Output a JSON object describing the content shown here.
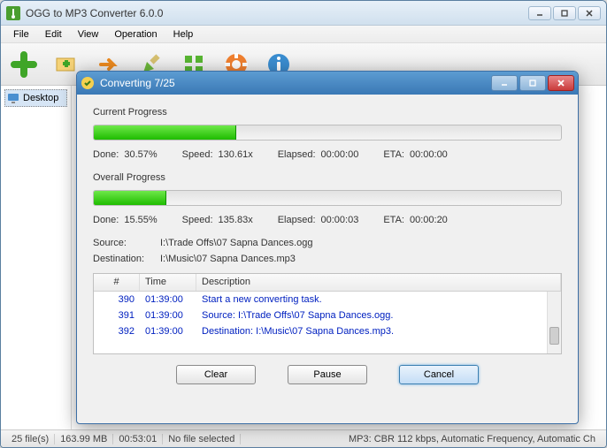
{
  "main": {
    "title": "OGG to MP3 Converter 6.0.0",
    "menu": [
      "File",
      "Edit",
      "View",
      "Operation",
      "Help"
    ],
    "tree": {
      "desktop": "Desktop"
    },
    "status": {
      "files": "25 file(s)",
      "size": "163.99 MB",
      "duration": "00:53:01",
      "sel": "No file selected",
      "fmt": "MP3: CBR 112 kbps, Automatic Frequency, Automatic Ch"
    }
  },
  "dialog": {
    "title": "Converting 7/25",
    "current": {
      "label": "Current Progress",
      "percent": 30.57,
      "done_lbl": "Done:",
      "done": "30.57%",
      "speed_lbl": "Speed:",
      "speed": "130.61x",
      "elapsed_lbl": "Elapsed:",
      "elapsed": "00:00:00",
      "eta_lbl": "ETA:",
      "eta": "00:00:00"
    },
    "overall": {
      "label": "Overall Progress",
      "percent": 15.55,
      "done_lbl": "Done:",
      "done": "15.55%",
      "speed_lbl": "Speed:",
      "speed": "135.83x",
      "elapsed_lbl": "Elapsed:",
      "elapsed": "00:00:03",
      "eta_lbl": "ETA:",
      "eta": "00:00:20"
    },
    "source_lbl": "Source:",
    "source": "I:\\Trade Offs\\07  Sapna Dances.ogg",
    "dest_lbl": "Destination:",
    "dest": "I:\\Music\\07  Sapna Dances.mp3",
    "log": {
      "headers": {
        "n": "#",
        "t": "Time",
        "d": "Description"
      },
      "rows": [
        {
          "n": "390",
          "t": "01:39:00",
          "d": "Start a new converting task."
        },
        {
          "n": "391",
          "t": "01:39:00",
          "d": "Source:  I:\\Trade Offs\\07  Sapna Dances.ogg."
        },
        {
          "n": "392",
          "t": "01:39:00",
          "d": "Destination: I:\\Music\\07  Sapna Dances.mp3."
        }
      ]
    },
    "buttons": {
      "clear": "Clear",
      "pause": "Pause",
      "cancel": "Cancel"
    }
  }
}
